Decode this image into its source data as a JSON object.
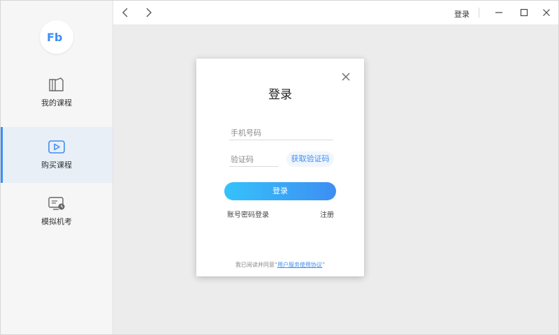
{
  "sidebar": {
    "logo_text": "Fb",
    "items": [
      {
        "label": "我的课程",
        "icon": "book-icon",
        "active": false
      },
      {
        "label": "购买课程",
        "icon": "play-icon",
        "active": true
      },
      {
        "label": "模拟机考",
        "icon": "monitor-clock-icon",
        "active": false
      }
    ]
  },
  "topbar": {
    "login_label": "登录"
  },
  "modal": {
    "title": "登录",
    "phone_placeholder": "手机号码",
    "code_placeholder": "验证码",
    "get_code_label": "获取验证码",
    "login_button": "登录",
    "password_login": "账号密码登录",
    "register": "注册",
    "agreement_prefix": "我已阅读并同意",
    "agreement_link": "用户服务使用协议",
    "quote_open": "“",
    "quote_close": "”"
  },
  "colors": {
    "accent": "#3d8ef2",
    "gradient_start": "#36c2fb",
    "sidebar_bg": "#f6f6f6",
    "active_bg": "#e9eff7"
  }
}
